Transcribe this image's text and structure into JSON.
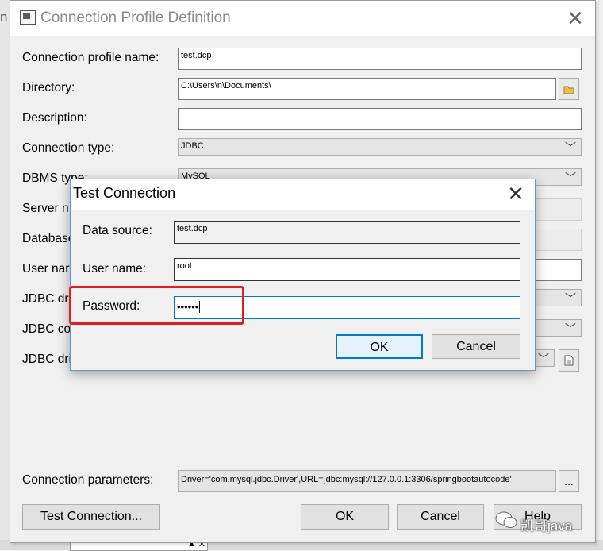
{
  "main_dialog": {
    "title": "Connection Profile Definition",
    "fields": {
      "profile_name": {
        "label": "Connection profile name:",
        "value": "test.dcp"
      },
      "directory": {
        "label": "Directory:",
        "value": "C:\\Users\\n\\Documents\\"
      },
      "description": {
        "label": "Description:",
        "value": ""
      },
      "connection_type": {
        "label": "Connection type:",
        "value": "JDBC"
      },
      "dbms_type": {
        "label": "DBMS type:",
        "value": "MySQL"
      },
      "server_name": {
        "label": "Server n"
      },
      "database": {
        "label": "Database"
      },
      "user_name": {
        "label": "User nar"
      },
      "jdbc_driver": {
        "label": "JDBC dr"
      },
      "jdbc_connection": {
        "label": "JDBC co"
      },
      "jdbc_driver_file": {
        "label": "JDBC dri"
      },
      "connection_parameters": {
        "label": "Connection parameters:",
        "value": "Driver='com.mysql.jdbc.Driver',URL=]dbc:mysql://127.0.0.1:3306/springbootautocode'"
      }
    },
    "buttons": {
      "test_connection": "Test Connection...",
      "ok": "OK",
      "cancel": "Cancel",
      "help": "Help",
      "ellipsis": "..."
    }
  },
  "test_dialog": {
    "title": "Test Connection",
    "data_source": {
      "label": "Data source:",
      "value": "test.dcp"
    },
    "user_name": {
      "label": "User name:",
      "value": "root"
    },
    "password": {
      "label": "Password:",
      "value": "••••••"
    },
    "buttons": {
      "ok": "OK",
      "cancel": "Cancel"
    }
  },
  "background": {
    "left_edge_text": "n"
  },
  "watermark": {
    "text": "凯哥java"
  },
  "colors": {
    "highlight": "#e02020",
    "focus_border": "#0078d7"
  }
}
